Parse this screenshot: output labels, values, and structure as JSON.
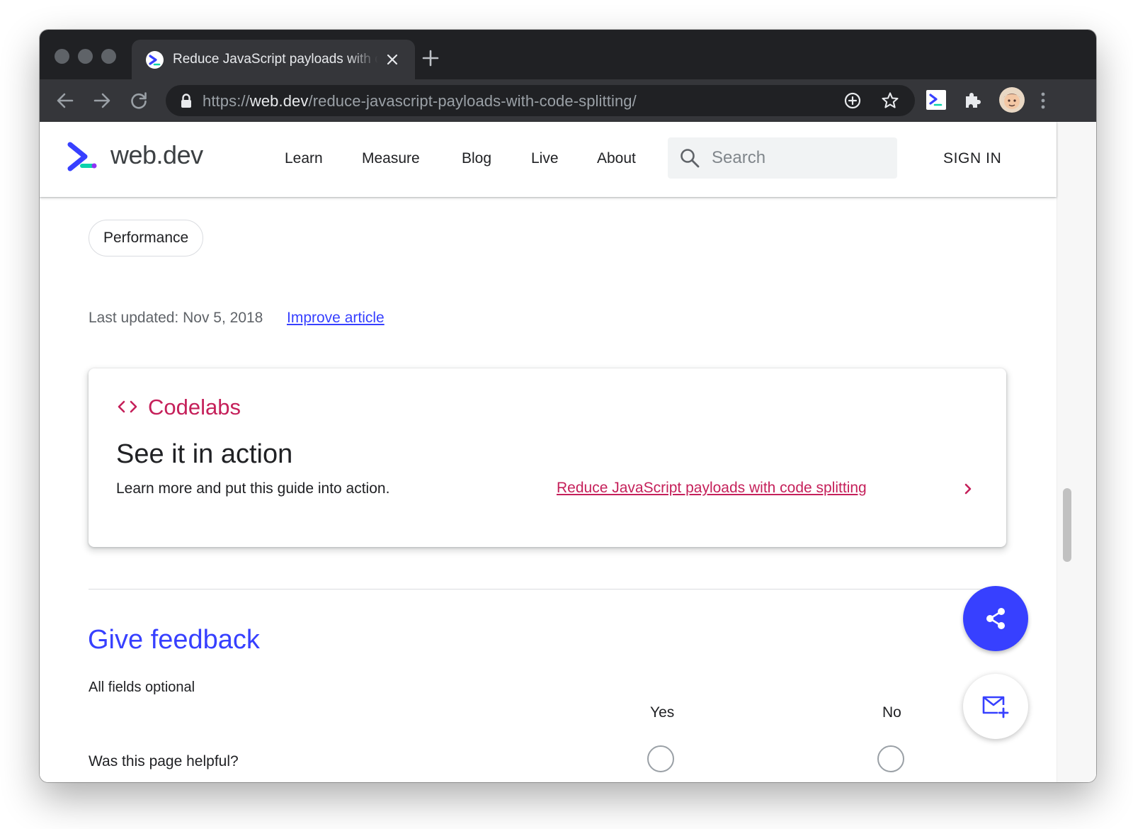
{
  "browser": {
    "tab_title": "Reduce JavaScript payloads with code splitting",
    "url_scheme": "https://",
    "url_host": "web.dev",
    "url_path": "/reduce-javascript-payloads-with-code-splitting/"
  },
  "header": {
    "logo_text": "web.dev",
    "nav": [
      "Learn",
      "Measure",
      "Blog",
      "Live",
      "About"
    ],
    "search_placeholder": "Search",
    "sign_in": "SIGN IN"
  },
  "article": {
    "tag": "Performance",
    "last_updated": "Last updated: Nov 5, 2018",
    "improve_link": "Improve article"
  },
  "codelab_card": {
    "eyebrow": "Codelabs",
    "title": "See it in action",
    "description": "Learn more and put this guide into action.",
    "link": "Reduce JavaScript payloads with code splitting"
  },
  "feedback": {
    "title": "Give feedback",
    "subtitle": "All fields optional",
    "col_yes": "Yes",
    "col_no": "No",
    "question": "Was this page helpful?"
  },
  "colors": {
    "brand_blue": "#3740ff",
    "codelab_pink": "#c5205a",
    "chrome_dark": "#202124",
    "chrome_toolbar": "#35363a"
  }
}
